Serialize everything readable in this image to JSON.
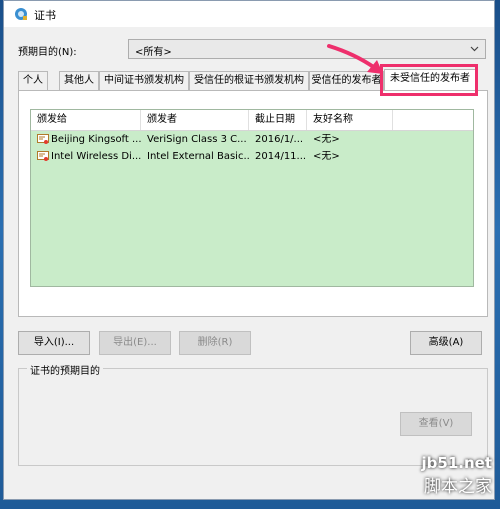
{
  "window": {
    "title": "证书"
  },
  "purpose": {
    "label": "预期目的(N):",
    "value": "<所有>"
  },
  "tabs": [
    {
      "label": "个人"
    },
    {
      "label": "其他人"
    },
    {
      "label": "中间证书颁发机构"
    },
    {
      "label": "受信任的根证书颁发机构"
    },
    {
      "label": "受信任的发布者"
    },
    {
      "label": "未受信任的发布者"
    }
  ],
  "table": {
    "columns": [
      "颁发给",
      "颁发者",
      "截止日期",
      "友好名称"
    ],
    "rows": [
      [
        "Beijing Kingsoft ...",
        "VeriSign Class 3 C...",
        "2016/1/...",
        "<无>"
      ],
      [
        "Intel Wireless Di...",
        "Intel External Basic...",
        "2014/11...",
        "<无>"
      ]
    ]
  },
  "buttons": {
    "import": "导入(I)...",
    "export": "导出(E)...",
    "delete": "删除(R)",
    "advanced": "高级(A)",
    "view": "查看(V)"
  },
  "group": {
    "title": "证书的预期目的"
  },
  "watermark": {
    "domain": "jb51.net",
    "text": "脚本之家"
  },
  "colors": {
    "list_bg": "#c9ecc9",
    "highlight": "#ee2f6c"
  }
}
